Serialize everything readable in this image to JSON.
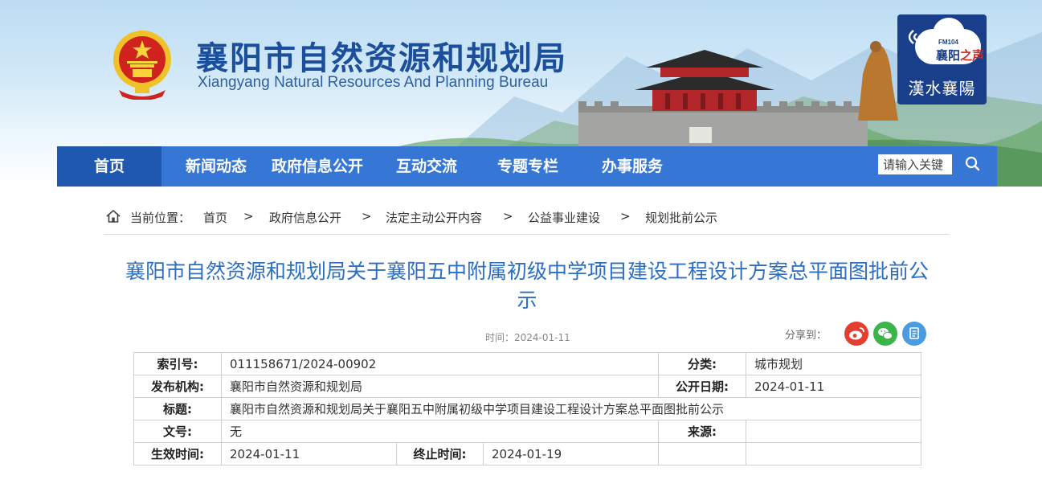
{
  "header": {
    "title": "襄阳市自然资源和规划局",
    "subtitle": "Xiangyang Natural Resources And Planning Bureau",
    "emblem_icon": "national-emblem-icon",
    "radio": {
      "fm": "FM104",
      "name_a": "襄阳",
      "name_b": "之声",
      "slogan": "漢水襄陽"
    }
  },
  "nav": {
    "items": [
      {
        "label": "首页",
        "active": true
      },
      {
        "label": "新闻动态"
      },
      {
        "label": "政府信息公开"
      },
      {
        "label": "互动交流"
      },
      {
        "label": "专题专栏"
      },
      {
        "label": "办事服务"
      }
    ],
    "search_placeholder": "请输入关键",
    "search_icon": "search-icon",
    "active_color": "#1f58b0",
    "bar_color": "#3677d6"
  },
  "breadcrumb": {
    "prefix": "当前位置：",
    "separator": ">",
    "items": [
      "首页",
      "政府信息公开",
      "法定主动公开内容",
      "公益事业建设",
      "规划批前公示"
    ]
  },
  "article": {
    "title": "襄阳市自然资源和规划局关于襄阳五中附属初级中学项目建设工程设计方案总平面图批前公示",
    "time_label": "时间：",
    "time": "2024-01-11",
    "share_label": "分享到：",
    "share_icons": [
      "weibo-icon",
      "wechat-icon",
      "qzone-icon"
    ],
    "title_color": "#2b6fc4"
  },
  "info": {
    "index_label": "索引号:",
    "index_value": "011158671/2024-00902",
    "category_label": "分类:",
    "category_value": "城市规划",
    "publisher_label": "发布机构:",
    "publisher_value": "襄阳市自然资源和规划局",
    "pubdate_label": "公开日期:",
    "pubdate_value": "2024-01-11",
    "title_label": "标题:",
    "title_value": "襄阳市自然资源和规划局关于襄阳五中附属初级中学项目建设工程设计方案总平面图批前公示",
    "docno_label": "文号:",
    "docno_value": "无",
    "source_label": "来源:",
    "source_value": "",
    "effective_label": "生效时间:",
    "effective_value": "2024-01-11",
    "end_label": "终止时间:",
    "end_value": "2024-01-19"
  }
}
